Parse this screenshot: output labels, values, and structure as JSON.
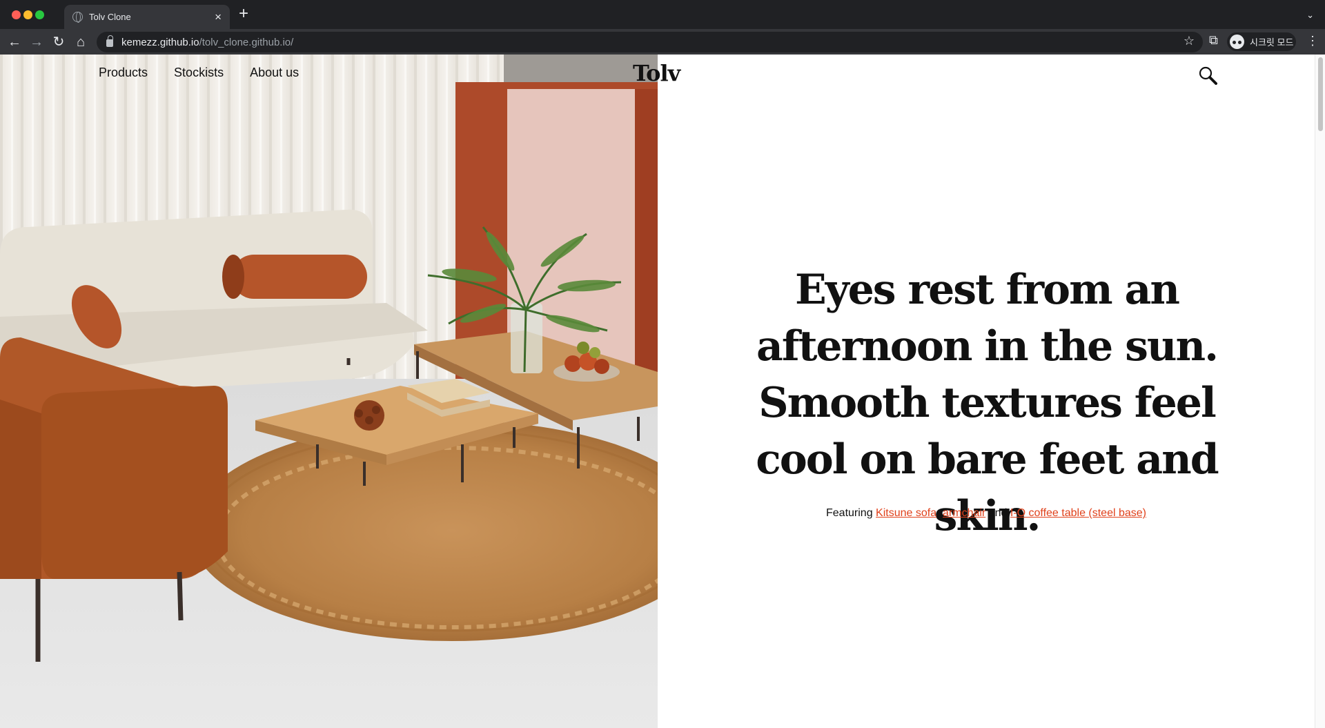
{
  "browser": {
    "tab_title": "Tolv Clone",
    "url_host": "kemezz.github.io",
    "url_path": "/tolv_clone.github.io/",
    "profile_label": "시크릿 모드",
    "icons": [
      "close-icon",
      "plus-icon",
      "back-arrow-icon",
      "forward-arrow-icon",
      "reload-icon",
      "home-icon",
      "lock-icon",
      "star-icon",
      "puzzle-icon",
      "incognito-icon",
      "kebab-menu-icon"
    ]
  },
  "site": {
    "logo": "Tolv",
    "nav": [
      "Products",
      "Stockists",
      "About us"
    ],
    "headline": "Eyes rest from an afternoon in the sun. Smooth textures feel cool on bare feet and skin.",
    "featuring_prefix": "Featuring",
    "links": [
      "Kitsune sofa",
      "armchair",
      "I-O coffee table (steel base)"
    ],
    "sep_comma": ",",
    "sep_and": "and",
    "link_color": "#e0411b"
  }
}
